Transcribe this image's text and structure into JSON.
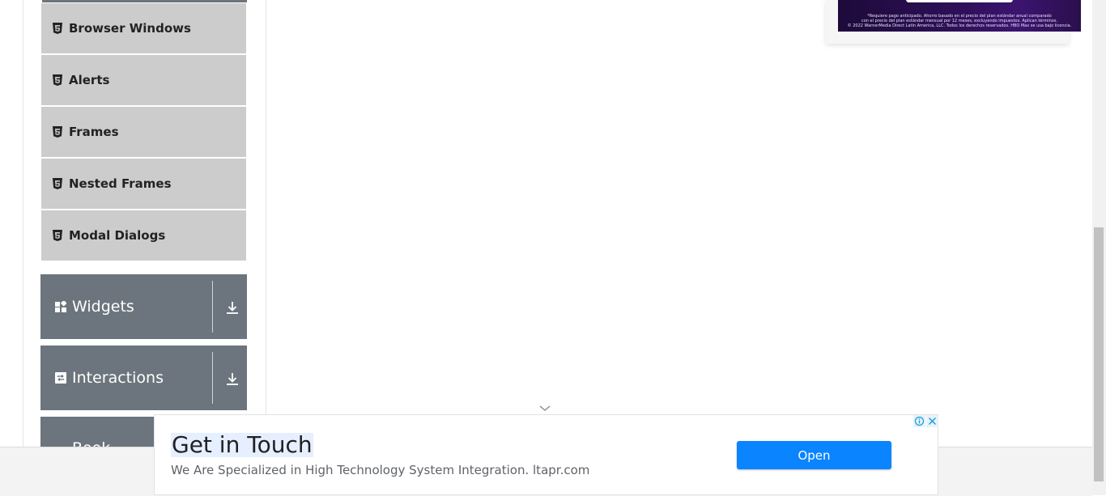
{
  "sidebar": {
    "items": [
      {
        "label": "Browser Windows",
        "icon": "html5-icon"
      },
      {
        "label": "Alerts",
        "icon": "html5-icon"
      },
      {
        "label": "Frames",
        "icon": "html5-icon"
      },
      {
        "label": "Nested Frames",
        "icon": "html5-icon"
      },
      {
        "label": "Modal Dialogs",
        "icon": "html5-icon"
      }
    ],
    "groups": [
      {
        "label": "Widgets",
        "icon": "widgets-icon"
      },
      {
        "label": "Interactions",
        "icon": "interactions-icon"
      },
      {
        "label": "Book Store",
        "icon": "book-icon"
      }
    ]
  },
  "ad_top": {
    "fine_print_1": "*Requiere pago anticipado. Ahorro basado en el precio del plan estándar anual comparado",
    "fine_print_2": "con el precio del plan estándar mensual por 12 meses, excluyendo impuestos. Aplican términos.",
    "fine_print_3": "© 2022 WarnerMedia Direct Latin America, LLC. Todos los derechos reservados. HBO Max se usa bajo licencia."
  },
  "ad_bottom": {
    "title": "Get in Touch",
    "description": "We Are Specialized in High Technology System Integration. ltapr.com",
    "button": "Open"
  },
  "colors": {
    "menu_item_bg": "#cccccc",
    "group_bg": "#6c757d",
    "ad_button": "#0a84ff"
  }
}
